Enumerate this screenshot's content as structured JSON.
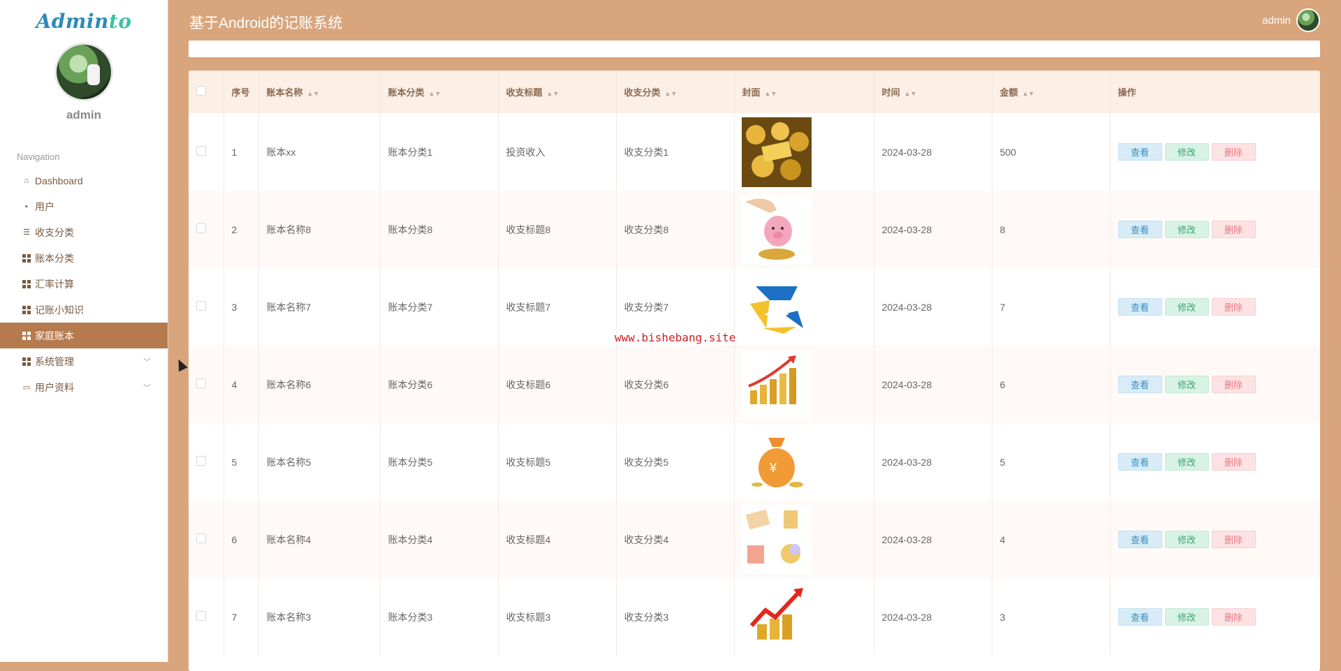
{
  "app": {
    "logo_main": "Admin",
    "logo_accent": "to",
    "title": "基于Android的记账系统"
  },
  "user": {
    "name": "admin",
    "header_name": "admin"
  },
  "sidebar": {
    "nav_title": "Navigation",
    "items": [
      {
        "label": "Dashboard",
        "icon": "home-icon"
      },
      {
        "label": "用户",
        "icon": "chat-icon"
      },
      {
        "label": "收支分类",
        "icon": "list-icon"
      },
      {
        "label": "账本分类",
        "icon": "grid-icon"
      },
      {
        "label": "汇率计算",
        "icon": "grid-icon"
      },
      {
        "label": "记账小知识",
        "icon": "grid-icon"
      },
      {
        "label": "家庭账本",
        "icon": "grid-icon",
        "active": true
      },
      {
        "label": "系统管理",
        "icon": "grid-icon",
        "expandable": true
      },
      {
        "label": "用户资料",
        "icon": "calendar-icon",
        "expandable": true
      }
    ]
  },
  "table": {
    "headers": [
      "序号",
      "账本名称",
      "账本分类",
      "收支标题",
      "收支分类",
      "封面",
      "时间",
      "金额",
      "操作"
    ],
    "rows": [
      {
        "no": "1",
        "book": "账本xx",
        "bcat": "账本分类1",
        "title": "投资收入",
        "icat": "收支分类1",
        "cover": "gold-coins",
        "date": "2024-03-28",
        "amount": "500"
      },
      {
        "no": "2",
        "book": "账本名称8",
        "bcat": "账本分类8",
        "title": "收支标题8",
        "icat": "收支分类8",
        "cover": "piggy-bank",
        "date": "2024-03-28",
        "amount": "8"
      },
      {
        "no": "3",
        "book": "账本名称7",
        "bcat": "账本分类7",
        "title": "收支标题7",
        "icat": "收支分类7",
        "cover": "bank-logo",
        "date": "2024-03-28",
        "amount": "7"
      },
      {
        "no": "4",
        "book": "账本名称6",
        "bcat": "账本分类6",
        "title": "收支标题6",
        "icat": "收支分类6",
        "cover": "growth-coins",
        "date": "2024-03-28",
        "amount": "6"
      },
      {
        "no": "5",
        "book": "账本名称5",
        "bcat": "账本分类5",
        "title": "收支标题5",
        "icat": "收支分类5",
        "cover": "money-bag",
        "date": "2024-03-28",
        "amount": "5"
      },
      {
        "no": "6",
        "book": "账本名称4",
        "bcat": "账本分类4",
        "title": "收支标题4",
        "icat": "收支分类4",
        "cover": "finance-icons",
        "date": "2024-03-28",
        "amount": "4"
      },
      {
        "no": "7",
        "book": "账本名称3",
        "bcat": "账本分类3",
        "title": "收支标题3",
        "icat": "收支分类3",
        "cover": "rising-arrow",
        "date": "2024-03-28",
        "amount": "3"
      }
    ],
    "actions": {
      "view": "查看",
      "edit": "修改",
      "delete": "删除"
    }
  },
  "watermark": "www.bishebang.site",
  "colors": {
    "background": "#d8a57c",
    "sidebar_active": "#b57a4d",
    "header_row": "#fbefe6"
  }
}
